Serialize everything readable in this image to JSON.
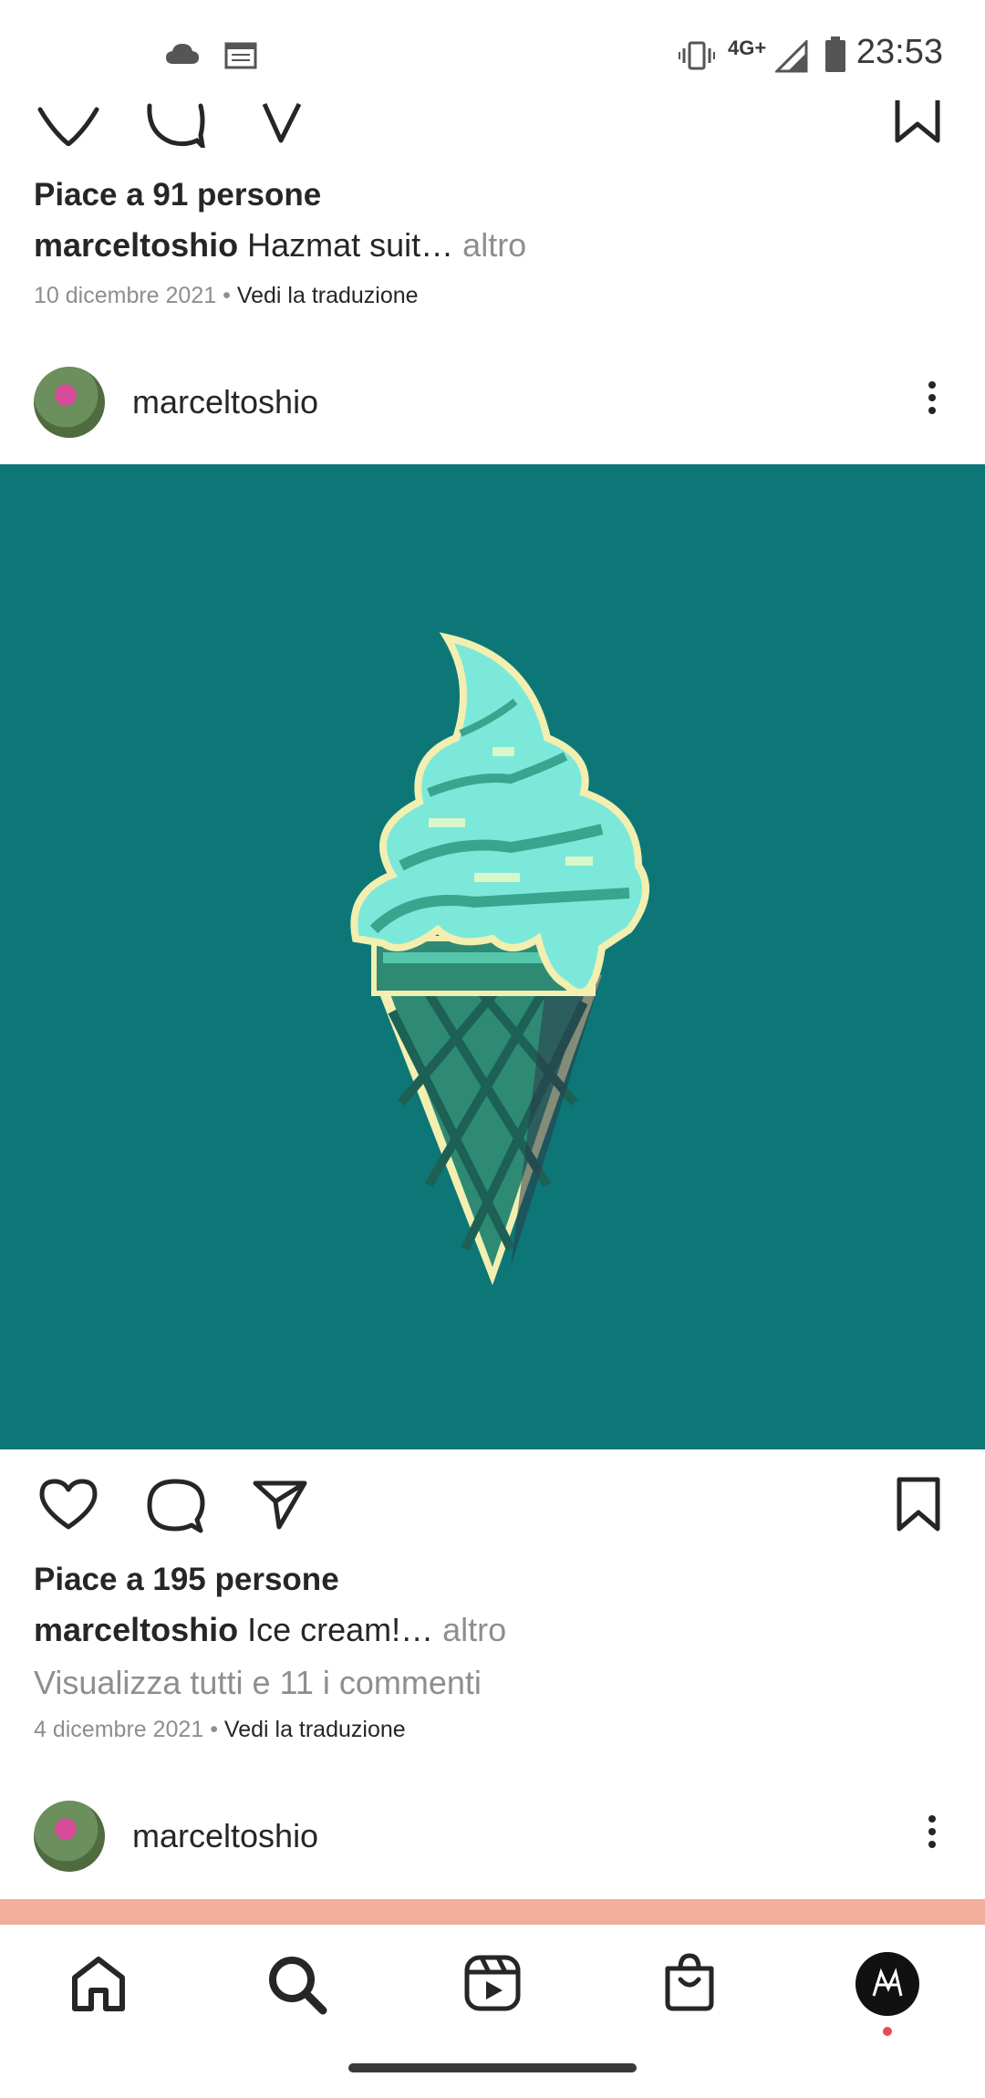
{
  "status_bar": {
    "time": "23:53",
    "network": "4G+",
    "icons": [
      "cloud-icon",
      "calendar-icon",
      "vibrate-icon",
      "signal-icon",
      "battery-icon"
    ]
  },
  "post_previous": {
    "likes": "Piace a 91 persone",
    "username": "marceltoshio",
    "caption": "Hazmat suit…",
    "more": "altro",
    "date": "10 dicembre 2021",
    "translate": "Vedi la traduzione"
  },
  "post_main": {
    "username": "marceltoshio",
    "image_subject": "pixel art ice cream cone",
    "image_background": "#0d7777",
    "likes": "Piace a 195 persone",
    "caption": "Ice cream!…",
    "more": "altro",
    "comments": "Visualizza tutti e 11 i commenti",
    "date": "4 dicembre 2021",
    "translate": "Vedi la traduzione"
  },
  "post_next": {
    "username": "marceltoshio"
  },
  "navbar": {
    "items": [
      "home-icon",
      "search-icon",
      "reels-icon",
      "shop-icon",
      "profile-avatar"
    ],
    "notification_color": "#ed4956"
  },
  "separator": "•"
}
